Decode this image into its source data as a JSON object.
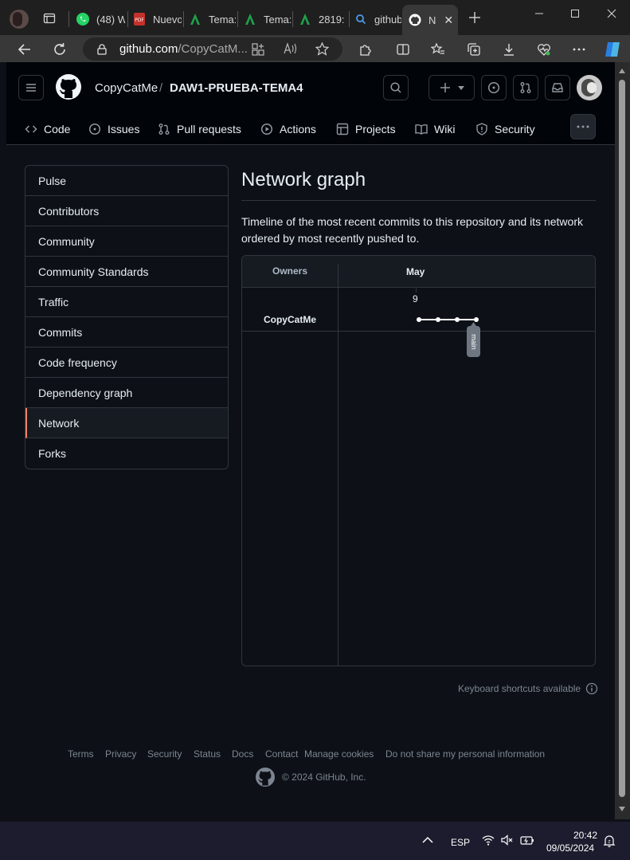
{
  "browser": {
    "tabs": [
      {
        "label": "(48) W",
        "icon": "whatsapp-icon"
      },
      {
        "label": "Nuevo",
        "icon": "pdf-icon"
      },
      {
        "label": "Tema:",
        "icon": "angular-icon"
      },
      {
        "label": "Tema:",
        "icon": "angular-icon"
      },
      {
        "label": "2819:",
        "icon": "angular-icon"
      },
      {
        "label": "github",
        "icon": "search-icon"
      },
      {
        "label": "N",
        "icon": "github-icon"
      }
    ],
    "url_host": "github.com",
    "url_path": "/CopyCatM..."
  },
  "header": {
    "owner": "CopyCatMe",
    "separator": "/",
    "repo": "DAW1-PRUEBA-TEMA4"
  },
  "repo_nav": [
    {
      "label": "Code",
      "icon": "code-icon"
    },
    {
      "label": "Issues",
      "icon": "issue-icon"
    },
    {
      "label": "Pull requests",
      "icon": "pull-request-icon"
    },
    {
      "label": "Actions",
      "icon": "play-icon"
    },
    {
      "label": "Projects",
      "icon": "table-icon"
    },
    {
      "label": "Wiki",
      "icon": "book-icon"
    },
    {
      "label": "Security",
      "icon": "shield-icon"
    }
  ],
  "sidebar": {
    "items": [
      "Pulse",
      "Contributors",
      "Community",
      "Community Standards",
      "Traffic",
      "Commits",
      "Code frequency",
      "Dependency graph",
      "Network",
      "Forks"
    ],
    "selected": "Network"
  },
  "main": {
    "title": "Network graph",
    "description": "Timeline of the most recent commits to this repository and its network ordered by most recently pushed to."
  },
  "network_graph": {
    "owners_header": "Owners",
    "month": "May",
    "day": "9",
    "owner": "CopyCatMe",
    "commit_count": 4,
    "branch_label": "main"
  },
  "keyboard_shortcuts": "Keyboard shortcuts available",
  "footer": {
    "links": [
      "Terms",
      "Privacy",
      "Security",
      "Status",
      "Docs",
      "Contact",
      "Manage cookies",
      "Do not share my personal information"
    ],
    "copyright": "© 2024 GitHub, Inc."
  },
  "taskbar": {
    "language": "ESP",
    "time": "20:42",
    "date": "09/05/2024"
  },
  "colors": {
    "accent_selected": "#f78166",
    "page_bg": "#0d1117",
    "header_bg": "#010409",
    "border": "#30363d"
  }
}
